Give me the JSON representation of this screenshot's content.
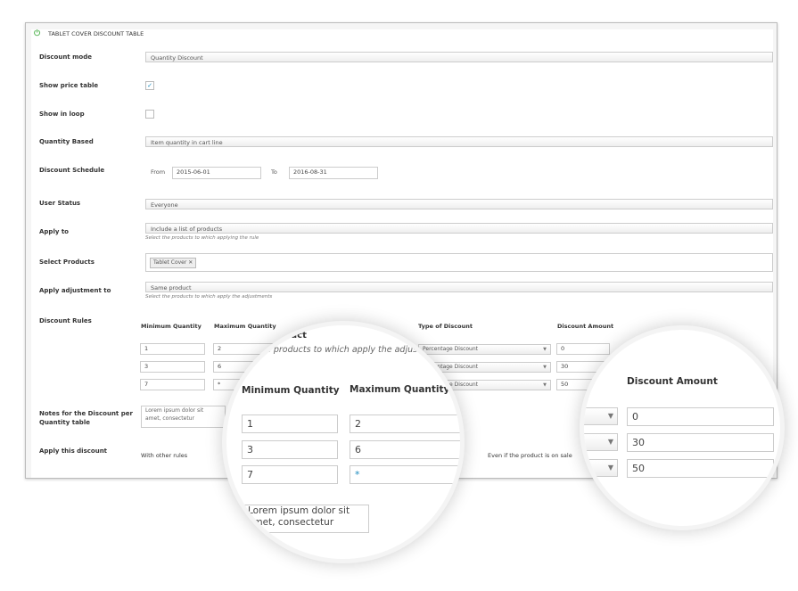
{
  "title": "TABLET COVER DISCOUNT TABLE",
  "icons": {
    "title": "power-icon"
  },
  "colors": {
    "accent": "#5cb85c",
    "check": "#1e8cbe"
  },
  "fields": {
    "discount_mode": {
      "label": "Discount mode",
      "value": "Quantity Discount"
    },
    "show_price_table": {
      "label": "Show price table",
      "checked": true
    },
    "show_in_loop": {
      "label": "Show in loop",
      "checked": false
    },
    "quantity_based": {
      "label": "Quantity Based",
      "value": "Item quantity in cart line"
    },
    "discount_schedule": {
      "label": "Discount Schedule",
      "from_label": "From",
      "from": "2015-06-01",
      "to_label": "To",
      "to": "2016-08-31"
    },
    "user_status": {
      "label": "User Status",
      "value": "Everyone"
    },
    "apply_to": {
      "label": "Apply to",
      "value": "Include a list of products",
      "hint": "Select the products to which applying the rule"
    },
    "select_products": {
      "label": "Select Products",
      "tags": [
        "Tablet Cover"
      ]
    },
    "apply_adjustment_to": {
      "label": "Apply adjustment to",
      "value": "Same product",
      "hint": "Select the products to which apply the adjustments"
    },
    "discount_rules": {
      "label": "Discount Rules",
      "headers": [
        "Minimum Quantity",
        "Maximum Quantity",
        "Type of Discount",
        "Discount Amount"
      ],
      "rows": [
        {
          "min": "1",
          "max": "2",
          "type": "Percentage Discount",
          "amount": "0"
        },
        {
          "min": "3",
          "max": "6",
          "type": "Percentage Discount",
          "amount": "30"
        },
        {
          "min": "7",
          "max": "*",
          "type": "Percentage Discount",
          "amount": "50"
        }
      ]
    },
    "notes": {
      "label": "Notes for the Discount per Quantity table",
      "value": "Lorem ipsum dolor sit amet, consectetur"
    },
    "apply_this_discount": {
      "label": "Apply this discount",
      "option1": "With other rules",
      "option2": "Even if the product is on sale"
    }
  },
  "magnifier_left": {
    "partial_value": "oduct",
    "partial_hint": "e products to which apply the adjustme"
  }
}
